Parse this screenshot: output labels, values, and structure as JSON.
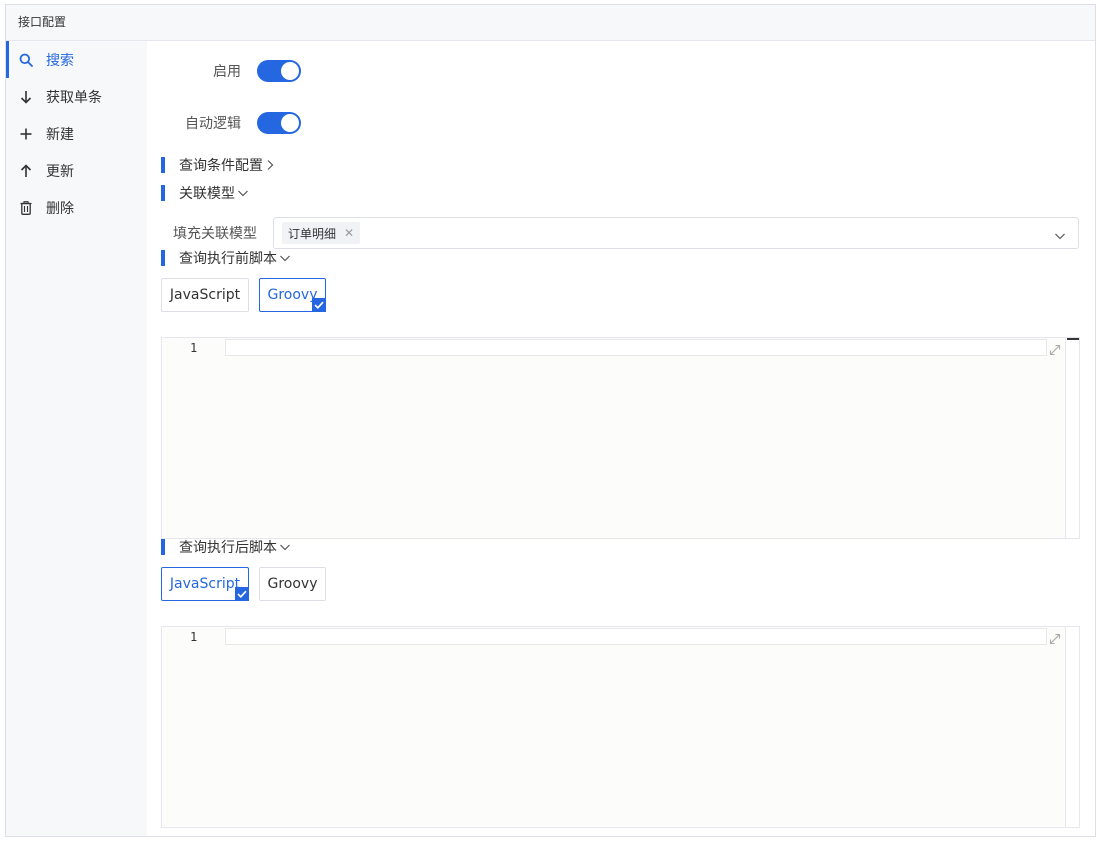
{
  "header": {
    "title": "接口配置"
  },
  "sidebar": {
    "items": [
      {
        "label": "搜索",
        "icon": "search-icon",
        "active": true
      },
      {
        "label": "获取单条",
        "icon": "arrow-down-icon",
        "active": false
      },
      {
        "label": "新建",
        "icon": "plus-icon",
        "active": false
      },
      {
        "label": "更新",
        "icon": "arrow-up-icon",
        "active": false
      },
      {
        "label": "删除",
        "icon": "trash-icon",
        "active": false
      }
    ]
  },
  "form": {
    "enable_label": "启用",
    "enable_on": true,
    "auto_logic_label": "自动逻辑",
    "auto_logic_on": true,
    "query_cond_section": "查询条件配置",
    "related_model_section": "关联模型",
    "fill_model_label": "填充关联模型",
    "fill_model_tags": [
      "订单明细"
    ],
    "before_script_section": "查询执行前脚本",
    "before_script": {
      "languages": [
        "JavaScript",
        "Groovy"
      ],
      "selected": "Groovy",
      "line_numbers": [
        "1"
      ]
    },
    "after_script_section": "查询执行后脚本",
    "after_script": {
      "languages": [
        "JavaScript",
        "Groovy"
      ],
      "selected": "JavaScript",
      "line_numbers": [
        "1"
      ]
    }
  },
  "colors": {
    "accent": "#2467e0",
    "sidebar_bg": "#f7f8fa",
    "border": "#dcdfe6"
  }
}
